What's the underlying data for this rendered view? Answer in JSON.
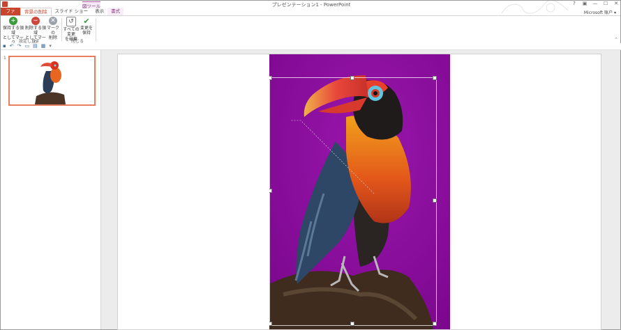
{
  "window": {
    "title": "プレゼンテーション1 - PowerPoint",
    "context_tool": "図ツール"
  },
  "window_buttons": [
    "?",
    "▣",
    "—",
    "☐",
    "✕"
  ],
  "tabs": [
    {
      "label": "ファイル"
    },
    {
      "label": "背景の削除"
    },
    {
      "label": "スライド ショー"
    },
    {
      "label": "表示"
    },
    {
      "label": "書式"
    }
  ],
  "account": {
    "label": "Microsoft 账户 ▾"
  },
  "ribbon": {
    "mark_keep": {
      "line1": "保持する領域",
      "line2": "としてマーク"
    },
    "mark_remove": {
      "line1": "削除する領域",
      "line2": "としてマーク"
    },
    "delete_mark": {
      "line1": "マークの",
      "line2": "削除"
    },
    "group_refine": "設定し直す",
    "discard_all": {
      "line1": "すべての変更",
      "line2": "を破棄"
    },
    "keep_changes": {
      "line1": "変更を",
      "line2": "保持"
    },
    "group_close": "閉じる"
  },
  "slides_panel": {
    "items": [
      {
        "number": "1"
      }
    ]
  },
  "colors": {
    "accent": "#c8442c",
    "picture_tools": "#8a3a86",
    "removed_area": "#8a0e9c"
  }
}
